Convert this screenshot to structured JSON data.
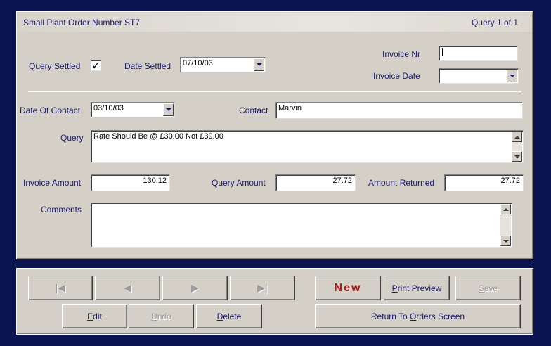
{
  "title": "Small Plant Order Number ST7",
  "query_counter": "Query 1 of 1",
  "form": {
    "query_settled_label": "Query Settled",
    "query_settled_checked": "✓",
    "date_settled_label": "Date Settled",
    "date_settled_value": "07/10/03",
    "invoice_nr_label": "Invoice Nr",
    "invoice_nr_value": "",
    "invoice_date_label": "Invoice Date",
    "invoice_date_value": "",
    "date_of_contact_label": "Date Of Contact",
    "date_of_contact_value": "03/10/03",
    "contact_label": "Contact",
    "contact_value": "Marvin",
    "query_label": "Query",
    "query_value": "Rate Should Be @ £30.00 Not £39.00",
    "invoice_amount_label": "Invoice Amount",
    "invoice_amount_value": "130.12",
    "query_amount_label": "Query Amount",
    "query_amount_value": "27.72",
    "amount_returned_label": "Amount Returned",
    "amount_returned_value": "27.72",
    "comments_label": "Comments",
    "comments_value": ""
  },
  "nav": {
    "first_glyph": "|◀",
    "prev_glyph": "◀",
    "next_glyph": "▶",
    "last_glyph": "▶|"
  },
  "buttons": {
    "new_label": "New",
    "print_preview_mn": "P",
    "print_preview_rest": "rint Preview",
    "save_mn": "S",
    "save_rest": "ave",
    "edit_mn": "E",
    "edit_rest": "dit",
    "undo_mn": "U",
    "undo_rest": "ndo",
    "delete_mn": "D",
    "delete_rest": "elete",
    "return_pre": "Return To ",
    "return_mn": "O",
    "return_rest": "rders Screen"
  }
}
